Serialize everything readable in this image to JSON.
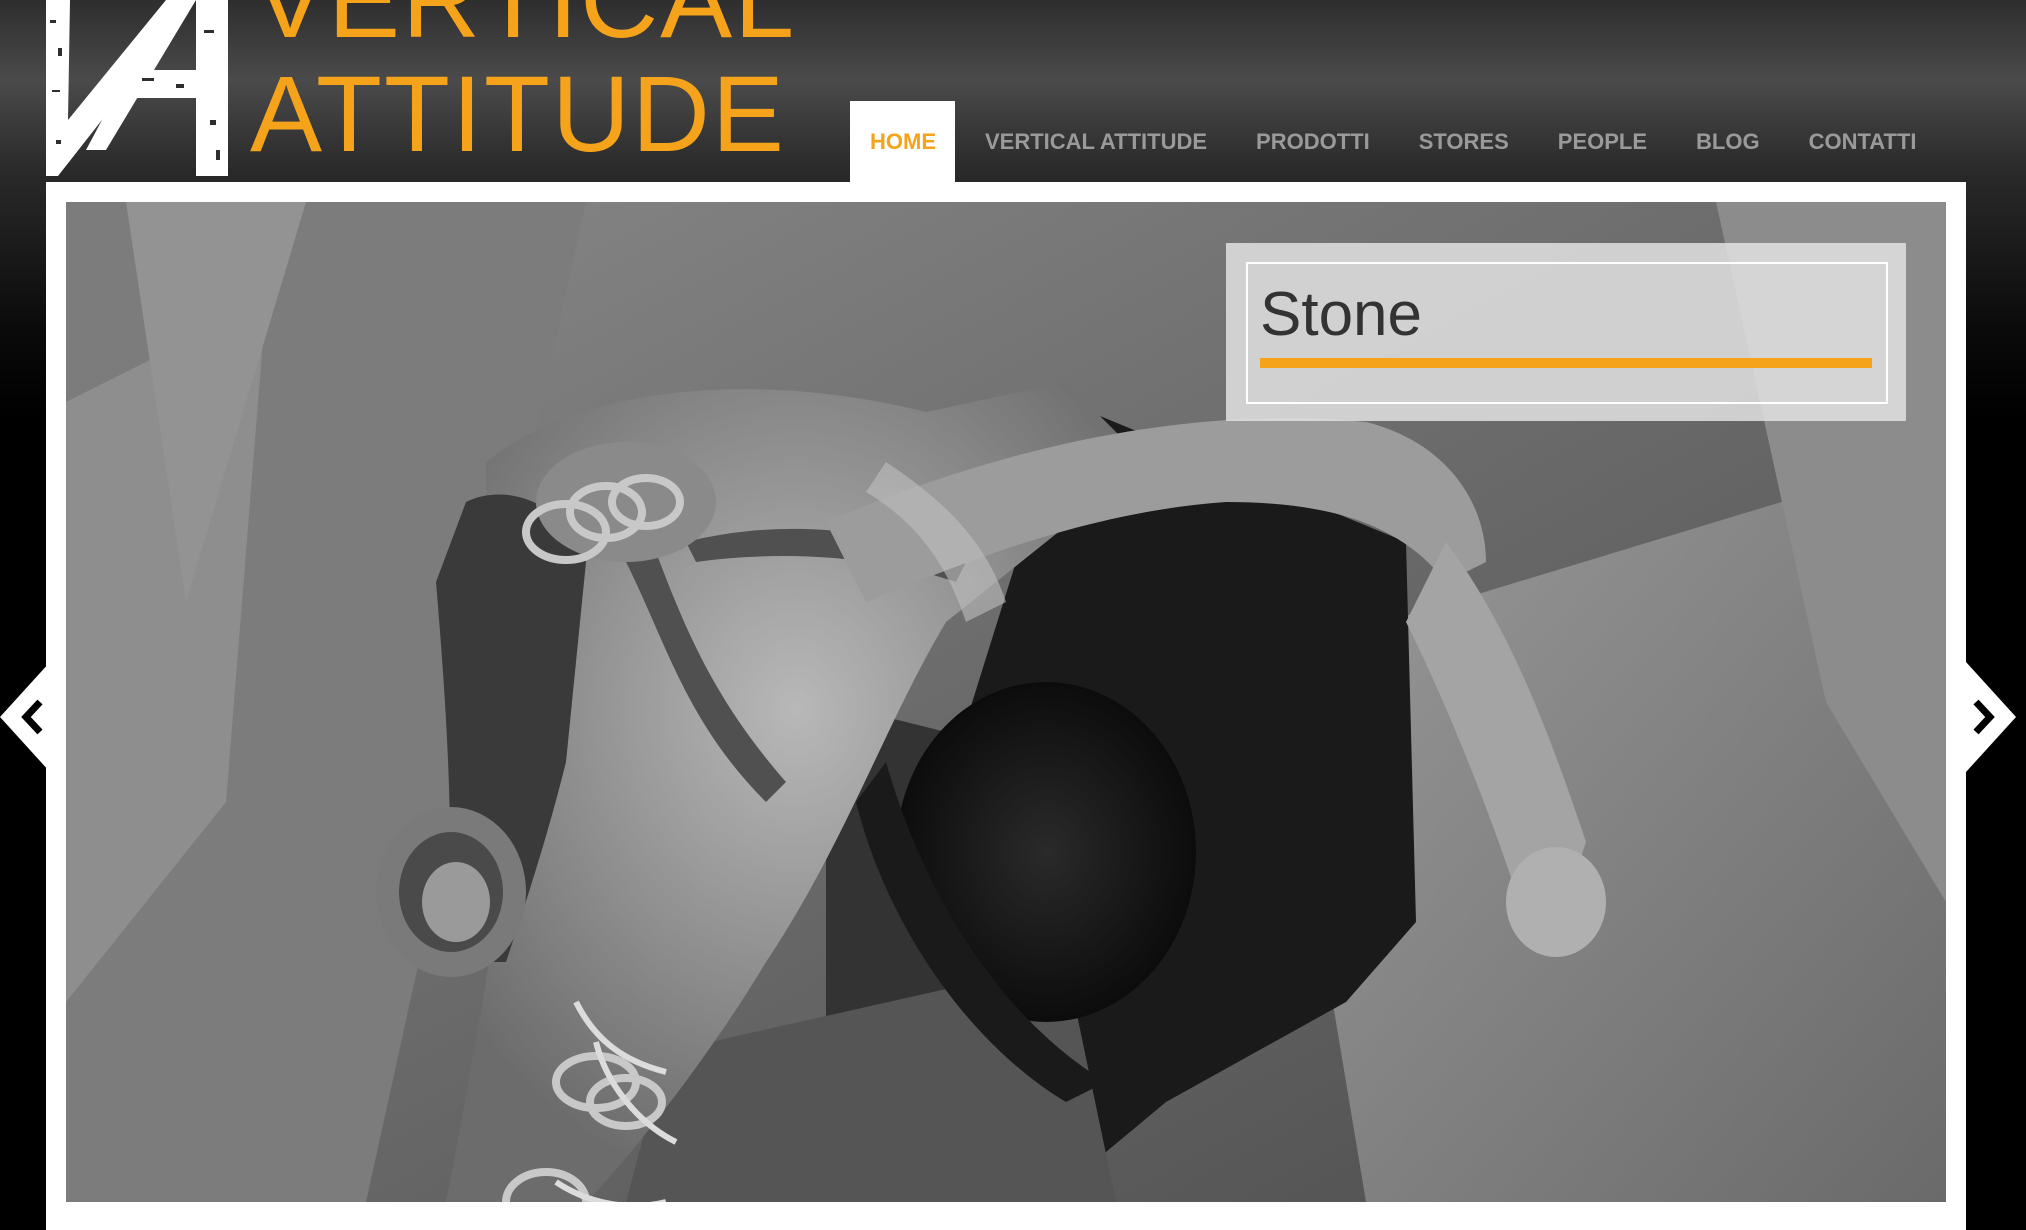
{
  "logo": {
    "line1": "VERTICAL",
    "line2": "ATTITUDE",
    "mark_icon": "va-monogram-icon"
  },
  "nav": {
    "items": [
      {
        "label": "HOME",
        "active": true
      },
      {
        "label": "VERTICAL ATTITUDE",
        "active": false
      },
      {
        "label": "PRODOTTI",
        "active": false
      },
      {
        "label": "STORES",
        "active": false
      },
      {
        "label": "PEOPLE",
        "active": false
      },
      {
        "label": "BLOG",
        "active": false
      },
      {
        "label": "CONTATTI",
        "active": false
      }
    ]
  },
  "slider": {
    "caption": {
      "title": "Stone"
    },
    "prev_icon": "chevron-left-icon",
    "next_icon": "chevron-right-icon"
  },
  "colors": {
    "accent": "#f5a31a",
    "nav_text": "#9a9a9a",
    "frame": "#ffffff"
  }
}
